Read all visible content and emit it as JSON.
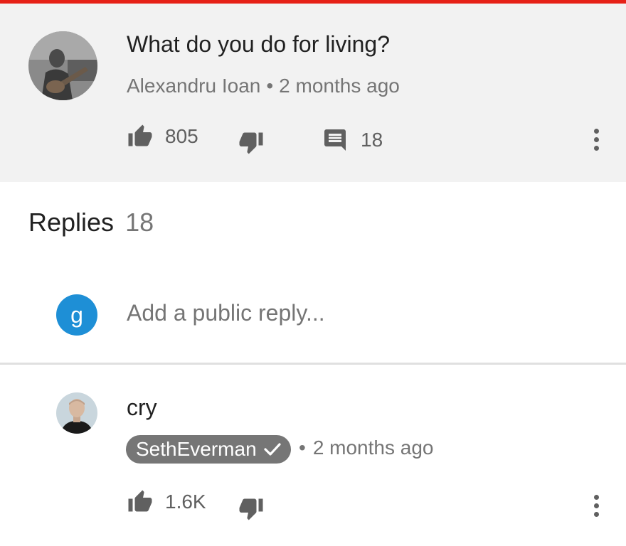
{
  "colors": {
    "accent": "#e62117",
    "panel": "#f2f2f2",
    "icon": "#606060",
    "meta": "#757575",
    "user_avatar": "#1e8fd6",
    "badge": "#767676"
  },
  "comment": {
    "text": "What do you do for living?",
    "author": "Alexandru Ioan",
    "separator": "•",
    "time": "2 months ago",
    "likes": "805",
    "reply_count": "18",
    "avatar_icon": "guitar-photo-avatar",
    "like_icon": "thumbs-up-icon",
    "dislike_icon": "thumbs-down-icon",
    "reply_icon": "comment-icon",
    "menu_icon": "more-vert-icon"
  },
  "replies": {
    "heading": "Replies",
    "count": "18"
  },
  "reply_box": {
    "avatar_letter": "g",
    "placeholder": "Add a public reply..."
  },
  "reply": {
    "text": "cry",
    "author": "SethEverman",
    "verified_icon": "checkmark-icon",
    "separator": "•",
    "time": "2 months ago",
    "likes": "1.6K"
  }
}
